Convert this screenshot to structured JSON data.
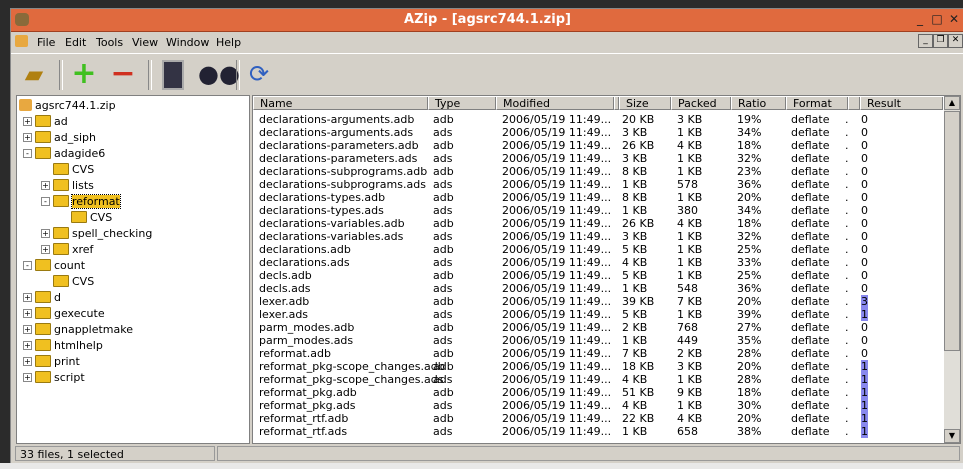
{
  "title": "AZip - [agsrc744.1.zip]",
  "menu": [
    "File",
    "Edit",
    "Tools",
    "View",
    "Window",
    "Help"
  ],
  "toolbar": [
    "open-archive",
    "add",
    "remove",
    "test",
    "find",
    "update"
  ],
  "tree": {
    "root": "agsrc744.1.zip",
    "nodes": [
      {
        "label": "ad",
        "level": 1,
        "exp": "+"
      },
      {
        "label": "ad_siph",
        "level": 1,
        "exp": "+"
      },
      {
        "label": "adagide6",
        "level": 1,
        "exp": "-"
      },
      {
        "label": "CVS",
        "level": 2,
        "exp": ""
      },
      {
        "label": "lists",
        "level": 2,
        "exp": "+"
      },
      {
        "label": "reformat",
        "level": 2,
        "exp": "-",
        "selected": true
      },
      {
        "label": "CVS",
        "level": 3,
        "exp": ""
      },
      {
        "label": "spell_checking",
        "level": 2,
        "exp": "+"
      },
      {
        "label": "xref",
        "level": 2,
        "exp": "+"
      },
      {
        "label": "count",
        "level": 1,
        "exp": "-"
      },
      {
        "label": "CVS",
        "level": 2,
        "exp": ""
      },
      {
        "label": "d",
        "level": 1,
        "exp": "+"
      },
      {
        "label": "gexecute",
        "level": 1,
        "exp": "+"
      },
      {
        "label": "gnappletmake",
        "level": 1,
        "exp": "+"
      },
      {
        "label": "htmlhelp",
        "level": 1,
        "exp": "+"
      },
      {
        "label": "print",
        "level": 1,
        "exp": "+"
      },
      {
        "label": "script",
        "level": 1,
        "exp": "+"
      }
    ]
  },
  "columns": [
    "Name",
    "Type",
    "Modified",
    "",
    "Size",
    "Packed",
    "Ratio",
    "Format",
    "",
    "Result"
  ],
  "rows": [
    [
      "declarations-arguments.adb",
      "adb",
      "2006/05/19  11:49...",
      "20 KB",
      "3 KB",
      "19%",
      "deflate",
      "0"
    ],
    [
      "declarations-arguments.ads",
      "ads",
      "2006/05/19  11:49...",
      "3 KB",
      "1 KB",
      "34%",
      "deflate",
      "0"
    ],
    [
      "declarations-parameters.adb",
      "adb",
      "2006/05/19  11:49...",
      "26 KB",
      "4 KB",
      "18%",
      "deflate",
      "0"
    ],
    [
      "declarations-parameters.ads",
      "ads",
      "2006/05/19  11:49...",
      "3 KB",
      "1 KB",
      "32%",
      "deflate",
      "0"
    ],
    [
      "declarations-subprograms.adb",
      "adb",
      "2006/05/19  11:49...",
      "8 KB",
      "1 KB",
      "23%",
      "deflate",
      "0"
    ],
    [
      "declarations-subprograms.ads",
      "ads",
      "2006/05/19  11:49...",
      "1 KB",
      "578",
      "36%",
      "deflate",
      "0"
    ],
    [
      "declarations-types.adb",
      "adb",
      "2006/05/19  11:49...",
      "8 KB",
      "1 KB",
      "20%",
      "deflate",
      "0"
    ],
    [
      "declarations-types.ads",
      "ads",
      "2006/05/19  11:49...",
      "1 KB",
      "380",
      "34%",
      "deflate",
      "0"
    ],
    [
      "declarations-variables.adb",
      "adb",
      "2006/05/19  11:49...",
      "26 KB",
      "4 KB",
      "18%",
      "deflate",
      "0"
    ],
    [
      "declarations-variables.ads",
      "ads",
      "2006/05/19  11:49...",
      "3 KB",
      "1 KB",
      "32%",
      "deflate",
      "0"
    ],
    [
      "declarations.adb",
      "adb",
      "2006/05/19  11:49...",
      "5 KB",
      "1 KB",
      "25%",
      "deflate",
      "0"
    ],
    [
      "declarations.ads",
      "ads",
      "2006/05/19  11:49...",
      "4 KB",
      "1 KB",
      "33%",
      "deflate",
      "0"
    ],
    [
      "decls.adb",
      "adb",
      "2006/05/19  11:49...",
      "5 KB",
      "1 KB",
      "25%",
      "deflate",
      "0"
    ],
    [
      "decls.ads",
      "ads",
      "2006/05/19  11:49...",
      "1 KB",
      "548",
      "36%",
      "deflate",
      "0"
    ],
    [
      "lexer.adb",
      "adb",
      "2006/05/19  11:49...",
      "39 KB",
      "7 KB",
      "20%",
      "deflate",
      "3"
    ],
    [
      "lexer.ads",
      "ads",
      "2006/05/19  11:49...",
      "5 KB",
      "1 KB",
      "39%",
      "deflate",
      "1"
    ],
    [
      "parm_modes.adb",
      "adb",
      "2006/05/19  11:49...",
      "2 KB",
      "768",
      "27%",
      "deflate",
      "0"
    ],
    [
      "parm_modes.ads",
      "ads",
      "2006/05/19  11:49...",
      "1 KB",
      "449",
      "35%",
      "deflate",
      "0"
    ],
    [
      "reformat.adb",
      "adb",
      "2006/05/19  11:49...",
      "7 KB",
      "2 KB",
      "28%",
      "deflate",
      "0"
    ],
    [
      "reformat_pkg-scope_changes.adb",
      "adb",
      "2006/05/19  11:49...",
      "18 KB",
      "3 KB",
      "20%",
      "deflate",
      "1"
    ],
    [
      "reformat_pkg-scope_changes.ads",
      "ads",
      "2006/05/19  11:49...",
      "4 KB",
      "1 KB",
      "28%",
      "deflate",
      "1"
    ],
    [
      "reformat_pkg.adb",
      "adb",
      "2006/05/19  11:49...",
      "51 KB",
      "9 KB",
      "18%",
      "deflate",
      "1"
    ],
    [
      "reformat_pkg.ads",
      "ads",
      "2006/05/19  11:49...",
      "4 KB",
      "1 KB",
      "30%",
      "deflate",
      "1"
    ],
    [
      "reformat_rtf.adb",
      "adb",
      "2006/05/19  11:49...",
      "22 KB",
      "4 KB",
      "20%",
      "deflate",
      "1"
    ],
    [
      "reformat_rtf.ads",
      "ads",
      "2006/05/19  11:49...",
      "1 KB",
      "658",
      "38%",
      "deflate",
      "1"
    ]
  ],
  "status": "33 files, 1 selected",
  "colors": {
    "title": "#e06a3e",
    "highlight": "#8888ee",
    "folder": "#f0c020"
  }
}
